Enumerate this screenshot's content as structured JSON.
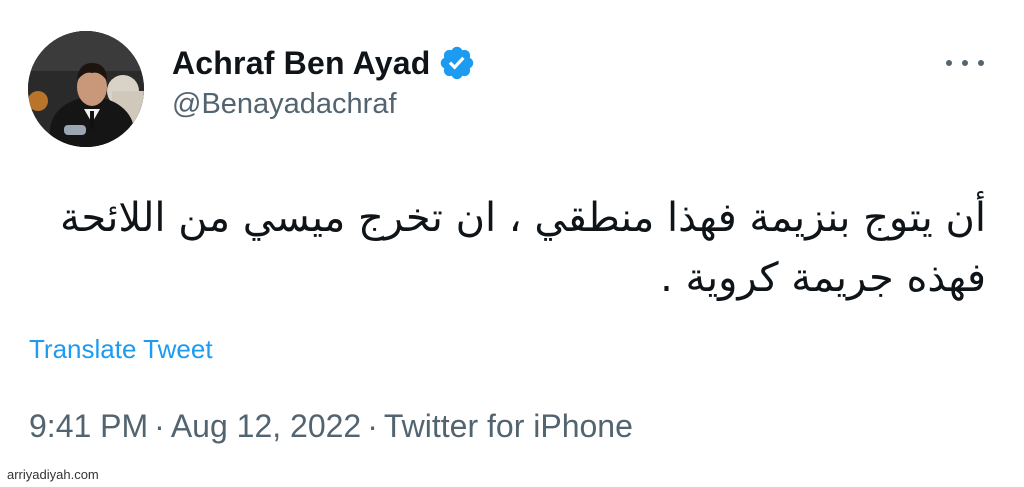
{
  "author": {
    "display_name": "Achraf Ben Ayad",
    "handle": "@Benayadachraf",
    "verified": true,
    "avatar_icon": "profile-photo"
  },
  "tweet": {
    "text": "أن يتوج بنزيمة فهذا منطقي ، ان تخرج ميسي من اللائحة فهذه جريمة كروية .",
    "translate_label": "Translate Tweet"
  },
  "meta": {
    "time": "9:41 PM",
    "separator": "·",
    "date": "Aug 12, 2022",
    "source": "Twitter for iPhone"
  },
  "menu": {
    "icon": "more-horizontal-icon"
  },
  "watermark": "arriyadiyah.com",
  "colors": {
    "text_primary": "#0f1419",
    "text_secondary": "#536471",
    "accent": "#1d9bf0"
  }
}
